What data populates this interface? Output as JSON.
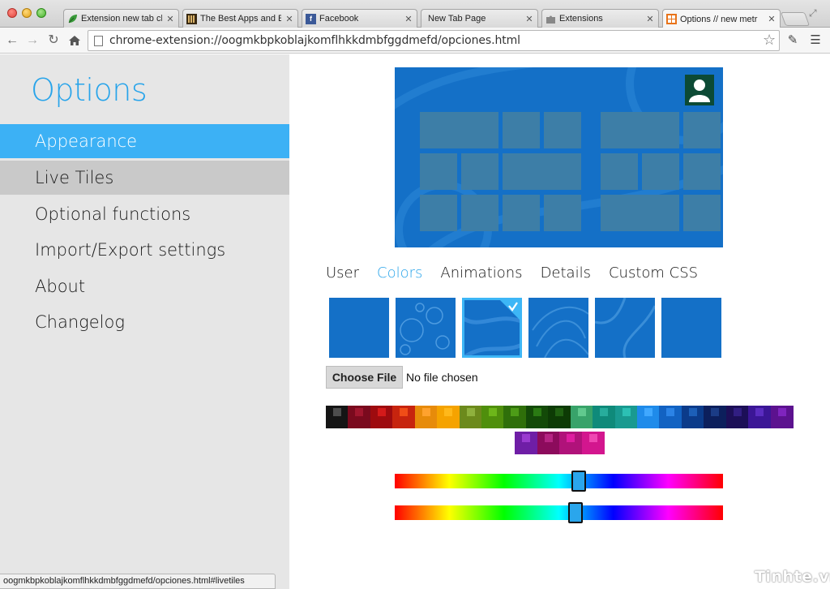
{
  "browser": {
    "tabs": [
      {
        "title": "Extension new tab cl",
        "favicon": "leaf-icon",
        "active": false
      },
      {
        "title": "The Best Apps and E",
        "favicon": "books-icon",
        "active": false
      },
      {
        "title": "Facebook",
        "favicon": "facebook-icon",
        "active": false
      },
      {
        "title": "New Tab Page",
        "favicon": "",
        "active": false
      },
      {
        "title": "Extensions",
        "favicon": "puzzle-icon",
        "active": false
      },
      {
        "title": "Options // new metr",
        "favicon": "metro-icon",
        "active": true
      }
    ],
    "url": "chrome-extension://oogmkbpkoblajkomflhkkdmbfggdmefd/opciones.html",
    "status_url": "oogmkbpkoblajkomflhkkdmbfggdmefd/opciones.html#livetiles"
  },
  "sidebar": {
    "title": "Options",
    "items": [
      {
        "label": "Appearance",
        "state": "selected"
      },
      {
        "label": "Live Tiles",
        "state": "hover"
      },
      {
        "label": "Optional functions",
        "state": ""
      },
      {
        "label": "Import/Export settings",
        "state": ""
      },
      {
        "label": "About",
        "state": ""
      },
      {
        "label": "Changelog",
        "state": ""
      }
    ]
  },
  "appearance": {
    "subtabs": [
      "User",
      "Colors",
      "Animations",
      "Details",
      "Custom CSS"
    ],
    "selected_subtab": "Colors",
    "background_samples_count_selected_index": 2,
    "file": {
      "button_label": "Choose File",
      "status": "No file chosen"
    },
    "palette_row1": [
      "#151515",
      "#7a0a1e",
      "#9e0b0f",
      "#c7240e",
      "#e78b0a",
      "#f5a300",
      "#6c8a1c",
      "#4f8f0c",
      "#2f6f0a",
      "#134a08",
      "#0d3b05",
      "#38a36a",
      "#0f8a7a",
      "#199a90",
      "#1f8bea",
      "#1262c2",
      "#0b3b8a",
      "#0c1f5c",
      "#1c0f57",
      "#3b1696",
      "#5c128f"
    ],
    "palette_row1_mini": [
      "#4d4d4d",
      "#a0162e",
      "#d41a1a",
      "#f04d17",
      "#ffa22e",
      "#ffb81a",
      "#8fb13d",
      "#6db61a",
      "#4d9c17",
      "#2a7a13",
      "#1f6011",
      "#61c98e",
      "#27ad9c",
      "#2cc0b4",
      "#40a8ff",
      "#2b83e6",
      "#1c5fb8",
      "#1b3c86",
      "#311e82",
      "#5a2cc0",
      "#7f24be"
    ],
    "palette_row2": [
      "#6f1ea6",
      "#8c0b5c",
      "#b0127a",
      "#d3168e"
    ],
    "palette_row2_mini": [
      "#9a3ad0",
      "#b52483",
      "#de1da0",
      "#ef47b2"
    ],
    "slider1_value": 0.56,
    "slider2_value": 0.55
  }
}
